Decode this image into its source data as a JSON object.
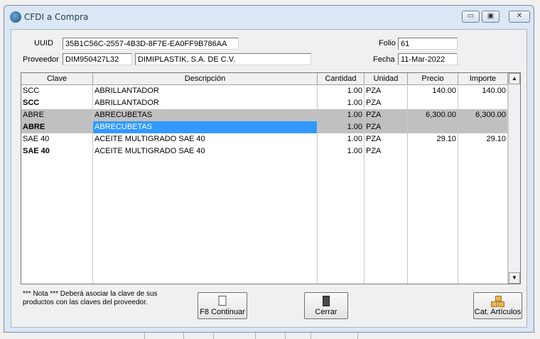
{
  "window": {
    "title": "CFDI a Compra"
  },
  "header": {
    "uuid_label": "UUID",
    "uuid_value": "35B1C56C-2557-4B3D-8F7E-EA0FF9B786AA",
    "proveedor_label": "Proveedor",
    "proveedor_rfc": "DIM950427L32",
    "proveedor_nombre": "DIMIPLASTIK, S.A. DE C.V.",
    "folio_label": "Folio",
    "folio_value": "61",
    "fecha_label": "Fecha",
    "fecha_value": "11-Mar-2022"
  },
  "grid": {
    "columns": [
      "Clave",
      "Descripción",
      "Cantidad",
      "Unidad",
      "Precio",
      "Importe"
    ],
    "rows": [
      {
        "clave": "SCC",
        "descripcion": "ABRILLANTADOR",
        "cantidad": "1.00",
        "unidad": "PZA",
        "precio": "140.00",
        "importe": "140.00",
        "style": "normal"
      },
      {
        "clave": "SCC",
        "descripcion": "ABRILLANTADOR",
        "cantidad": "1.00",
        "unidad": "PZA",
        "precio": "",
        "importe": "",
        "style": "bold"
      },
      {
        "clave": "ABRE",
        "descripcion": "ABRECUBETAS",
        "cantidad": "1.00",
        "unidad": "PZA",
        "precio": "6,300.00",
        "importe": "6,300.00",
        "style": "gray"
      },
      {
        "clave": "ABRE",
        "descripcion": "ABRECUBETAS",
        "cantidad": "1.00",
        "unidad": "PZA",
        "precio": "",
        "importe": "",
        "style": "blue"
      },
      {
        "clave": "SAE 40",
        "descripcion": "ACEITE MULTIGRADO SAE 40",
        "cantidad": "1.00",
        "unidad": "PZA",
        "precio": "29.10",
        "importe": "29.10",
        "style": "normal"
      },
      {
        "clave": "SAE 40",
        "descripcion": "ACEITE MULTIGRADO SAE 40",
        "cantidad": "1.00",
        "unidad": "PZA",
        "precio": "",
        "importe": "",
        "style": "bold"
      }
    ]
  },
  "footer": {
    "note_line1": "*** Nota *** Deberá asociar la clave de sus",
    "note_line2": "productos con las claves del proveedor.",
    "continuar_label": "F8 Continuar",
    "cerrar_label": "Cerrar",
    "articulos_label": "Cat. Artículos"
  },
  "colors": {
    "selection_blue": "#3399ff",
    "selection_gray": "#c0c0c0"
  }
}
